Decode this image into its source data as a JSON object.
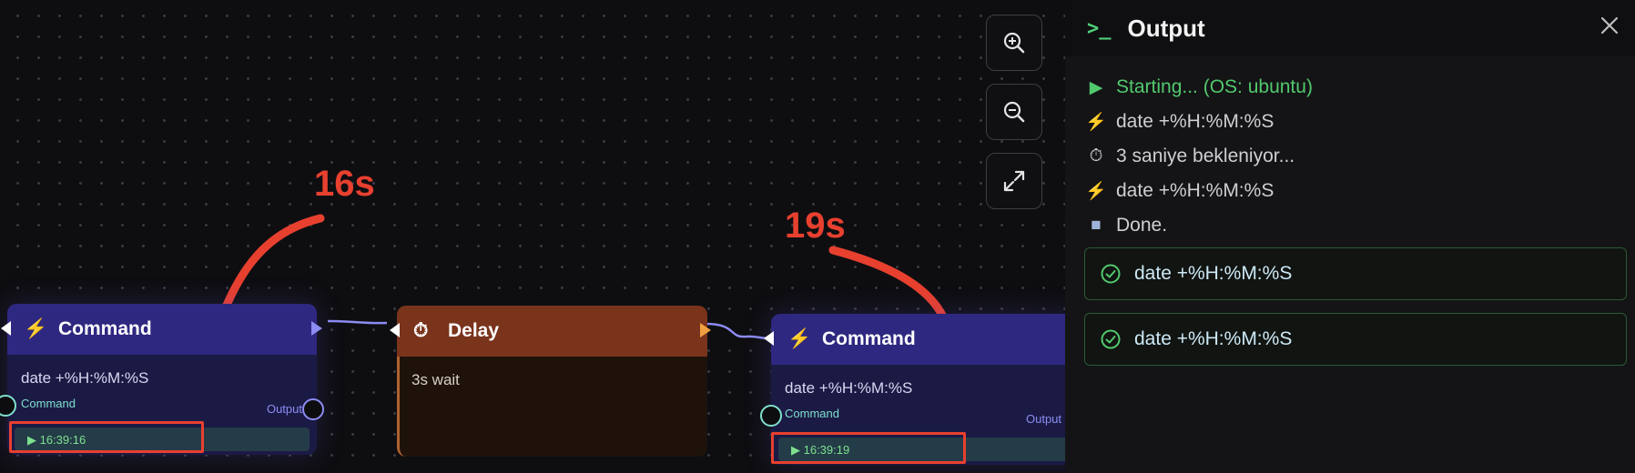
{
  "canvas": {
    "nodes": [
      {
        "kind": "command",
        "title": "Command",
        "icon": "lightning-icon",
        "command": "date +%H:%M:%S",
        "input_label": "Command",
        "output_label": "Output",
        "run_time": "16:39:16"
      },
      {
        "kind": "delay",
        "title": "Delay",
        "icon": "stopwatch-icon",
        "text": "3s wait"
      },
      {
        "kind": "command",
        "title": "Command",
        "icon": "lightning-icon",
        "command": "date +%H:%M:%S",
        "input_label": "Command",
        "output_label": "Output",
        "run_time": "16:39:19"
      }
    ],
    "annotations": [
      "16s",
      "19s"
    ],
    "controls": [
      "zoom-in-icon",
      "zoom-out-icon",
      "fit-view-icon"
    ],
    "colors": {
      "command_head": "#2e2880",
      "delay_head": "#7a341c",
      "annotation": "#e8402f",
      "wire": "#8c8cf2"
    }
  },
  "output_panel": {
    "prompt_symbol": ">_",
    "title": "Output",
    "logs": [
      {
        "icon": "▶",
        "text": "Starting... (OS: ubuntu)"
      },
      {
        "icon": "⚡",
        "text": "date +%H:%M:%S"
      },
      {
        "icon": "⏱",
        "text": "3 saniye bekleniyor..."
      },
      {
        "icon": "⚡",
        "text": "date +%H:%M:%S"
      },
      {
        "icon": "■",
        "text": "Done."
      }
    ],
    "results": [
      "date +%H:%M:%S",
      "date +%H:%M:%S"
    ],
    "colors": {
      "success": "#52c96d"
    }
  }
}
